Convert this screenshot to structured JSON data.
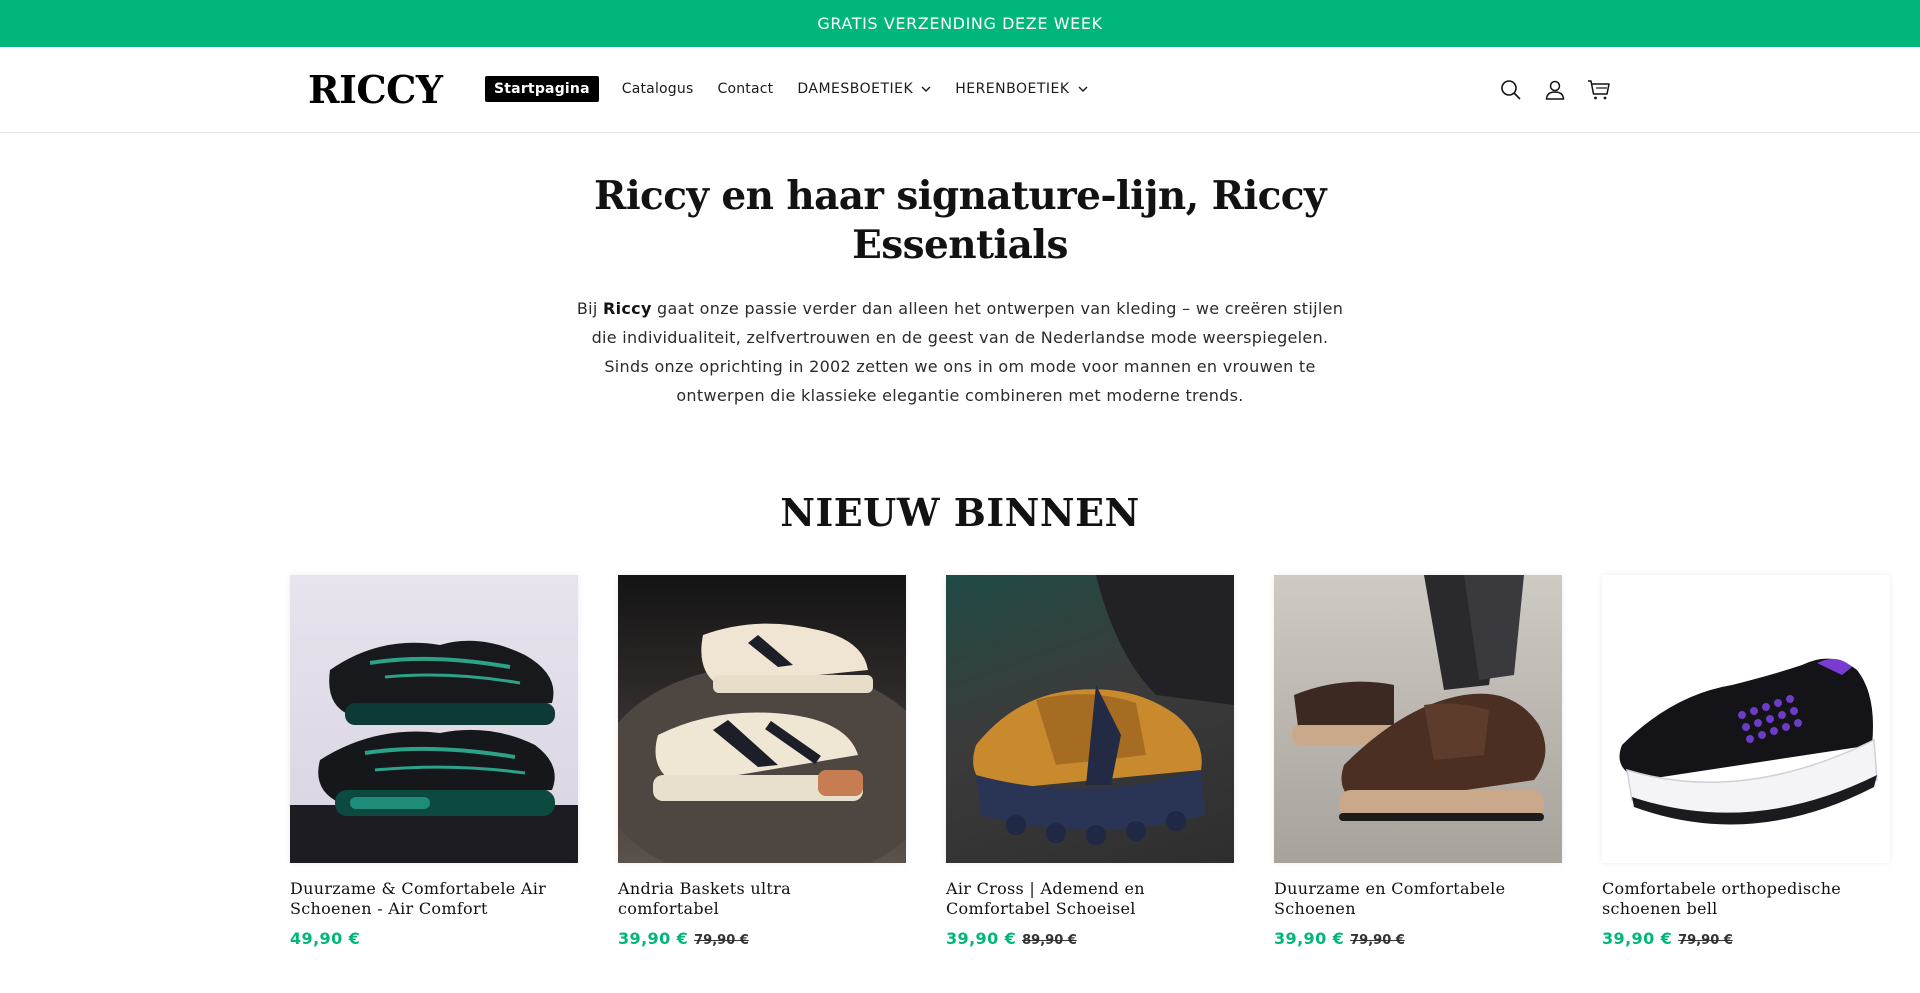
{
  "announcement": {
    "text": "GRATIS VERZENDING DEZE WEEK"
  },
  "header": {
    "logo": "RICCY",
    "nav": [
      {
        "label": "Startpagina",
        "active": true
      },
      {
        "label": "Catalogus"
      },
      {
        "label": "Contact"
      },
      {
        "label": "DAMESBOETIEK",
        "dropdown": true
      },
      {
        "label": "HERENBOETIEK",
        "dropdown": true
      }
    ],
    "icons": [
      "search-icon",
      "account-icon",
      "cart-icon"
    ]
  },
  "intro": {
    "title": "Riccy en haar signature-lijn, Riccy Essentials",
    "text_before": "Bij ",
    "brand": "Riccy",
    "text_after": " gaat onze passie verder dan alleen het ontwerpen van kleding – we creëren stijlen die individualiteit, zelfvertrouwen en de geest van de Nederlandse mode weerspiegelen. Sinds onze oprichting in 2002 zetten we ons in om mode voor mannen en vrouwen te ontwerpen die klassieke elegantie combineren met moderne trends."
  },
  "section": {
    "title": "NIEUW BINNEN"
  },
  "products": [
    {
      "title": "Duurzame & Comfortabele Air Schoenen - Air Comfort",
      "price": "49,90 €",
      "compare_price": ""
    },
    {
      "title": "Andria Baskets ultra comfortabel",
      "price": "39,90 €",
      "compare_price": "79,90 €"
    },
    {
      "title": "Air Cross | Ademend en Comfortabel Schoeisel",
      "price": "39,90 €",
      "compare_price": "89,90 €"
    },
    {
      "title": "Duurzame en Comfortabele Schoenen",
      "price": "39,90 €",
      "compare_price": "79,90 €"
    },
    {
      "title": "Comfortabele orthopedische schoenen bell",
      "price": "39,90 €",
      "compare_price": "79,90 €"
    }
  ],
  "colors": {
    "accent": "#00b67a",
    "text": "#121212",
    "nav_active_bg": "#000000"
  }
}
